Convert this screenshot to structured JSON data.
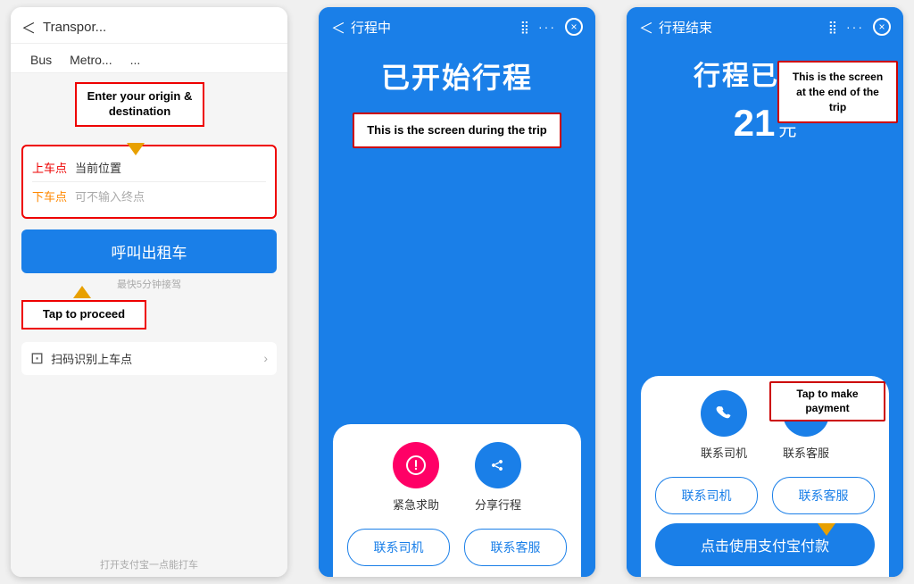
{
  "screen1": {
    "back_label": "＜",
    "title": "Transpor...",
    "tabs": [
      "Bus",
      "Metro...",
      "..."
    ],
    "annotation_enter": "Enter your origin\n& destination",
    "origin_label": "上车点",
    "origin_value": "当前位置",
    "destination_label": "下车点",
    "destination_placeholder": "可不输入终点",
    "call_taxi_label": "呼叫出租车",
    "fastest_label": "最快5分钟接驾",
    "tap_to_proceed": "Tap to proceed",
    "scan_label": "扫码识别上车点",
    "footer_label": "打开支付宝一点能打车"
  },
  "screen2": {
    "back_label": "＜",
    "title": "行程中",
    "grid_icon": "⣿",
    "dots_label": "···",
    "close_label": "×",
    "trip_started": "已开始行程",
    "during_trip_annotation": "This is the screen during the trip",
    "emergency_label": "紧急求助",
    "share_label": "分享行程",
    "contact_driver": "联系司机",
    "contact_service": "联系客服"
  },
  "screen3": {
    "back_label": "＜",
    "title": "行程结束",
    "grid_icon": "⣿",
    "dots_label": "···",
    "close_label": "×",
    "trip_ended": "行程已结束",
    "fare_amount": "21",
    "fare_unit": "元",
    "end_trip_annotation": "This is the screen at\nthe end of the trip",
    "contact_driver": "联系司机",
    "contact_service": "联系客服",
    "pay_label": "点击使用支付宝付款",
    "tap_payment_annotation": "Tap to make\npayment"
  }
}
